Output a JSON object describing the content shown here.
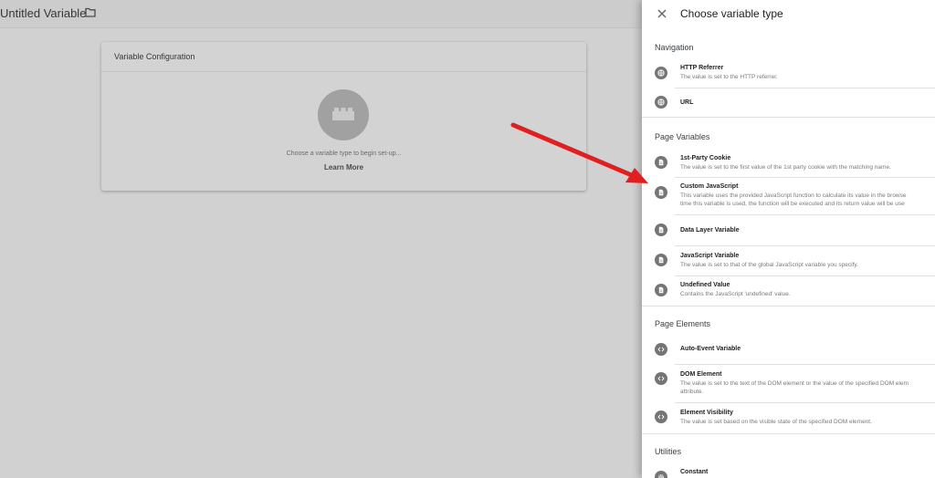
{
  "editor": {
    "title": "Untitled Variable",
    "card_title": "Variable Configuration",
    "hint": "Choose a variable type to begin set-up...",
    "learn_more": "Learn More"
  },
  "panel": {
    "title": "Choose variable type",
    "sections": {
      "navigation": "Navigation",
      "page_variables": "Page Variables",
      "page_elements": "Page Elements",
      "utilities": "Utilities"
    },
    "items": {
      "http_referrer": {
        "name": "HTTP Referrer",
        "desc": "The value is set to the HTTP referrer.",
        "icon": "globe-icon"
      },
      "url": {
        "name": "URL",
        "desc": "",
        "icon": "globe-icon"
      },
      "first_party_cookie": {
        "name": "1st-Party Cookie",
        "desc": "The value is set to the first value of the 1st party cookie with the matching name.",
        "icon": "document-icon"
      },
      "custom_js": {
        "name": "Custom JavaScript",
        "desc1": "This variable uses the provided JavaScript function to calculate its value in the browse",
        "desc2": "time this variable is used, the function will be executed and its return value will be use",
        "icon": "document-icon"
      },
      "data_layer": {
        "name": "Data Layer Variable",
        "icon": "document-icon"
      },
      "js_variable": {
        "name": "JavaScript Variable",
        "desc": "The value is set to that of the global JavaScript variable you specify.",
        "icon": "document-icon"
      },
      "undefined_value": {
        "name": "Undefined Value",
        "desc": "Contains the JavaScript 'undefined' value.",
        "icon": "document-icon"
      },
      "auto_event": {
        "name": "Auto-Event Variable",
        "icon": "code-icon"
      },
      "dom_element": {
        "name": "DOM Element",
        "desc1": "The value is set to the text of the DOM element or the value of the specified DOM elem",
        "desc2": "attribute.",
        "icon": "code-icon"
      },
      "element_visibility": {
        "name": "Element Visibility",
        "desc": "The value is set based on the visible state of the specified DOM element.",
        "icon": "code-icon"
      },
      "constant": {
        "name": "Constant",
        "icon": "gear-icon"
      }
    }
  },
  "colors": {
    "arrow": "#e02020",
    "icon": "#757575"
  }
}
